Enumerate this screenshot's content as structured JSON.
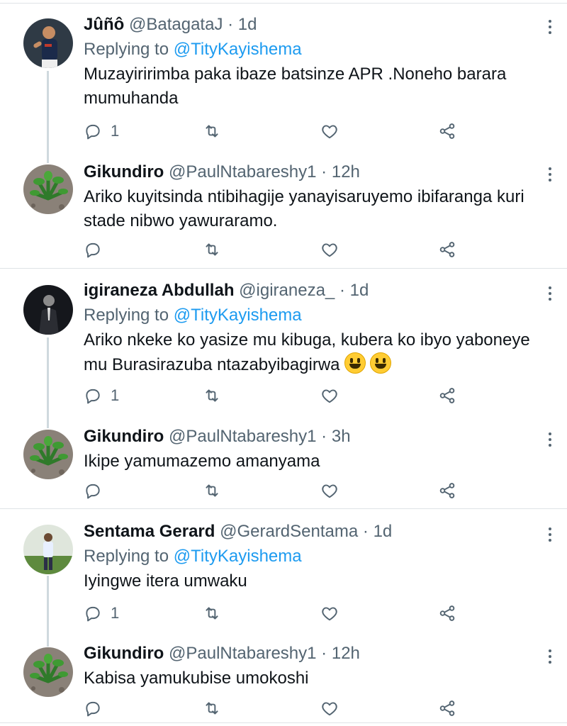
{
  "threads": [
    {
      "parent": {
        "name": "Jûñô",
        "handle": "@BatagataJ",
        "dot": "·",
        "time": "1d",
        "replying_prefix": "Replying to",
        "replying_to": "@TityKayishema",
        "text": "Muzayiririmba paka ibaze batsinze APR .Noneho barara mumuhanda",
        "reply_count": "1",
        "avatar": "soccer-player-avatar"
      },
      "reply": {
        "name": "Gikundiro",
        "handle": "@PaulNtabareshy1",
        "dot": "·",
        "time": "12h",
        "text": "Ariko kuyitsinda ntibihagije yanayisaruyemo ibifaranga kuri stade nibwo yawuraramo.",
        "reply_count": "",
        "avatar": "plant-avatar"
      }
    },
    {
      "parent": {
        "name": "igiraneza Abdullah",
        "handle": "@igiraneza_",
        "dot": "·",
        "time": "1d",
        "replying_prefix": "Replying to",
        "replying_to": "@TityKayishema",
        "text": "Ariko nkeke ko yasize mu kibuga, kubera ko ibyo yaboneye mu Burasirazuba ntazabyibagirwa",
        "reply_count": "1",
        "avatar": "man-in-suit-avatar"
      },
      "reply": {
        "name": "Gikundiro",
        "handle": "@PaulNtabareshy1",
        "dot": "·",
        "time": "3h",
        "text": "Ikipe yamumazemo amanyama",
        "reply_count": "",
        "avatar": "plant-avatar"
      }
    },
    {
      "parent": {
        "name": "Sentama Gerard",
        "handle": "@GerardSentama",
        "dot": "·",
        "time": "1d",
        "replying_prefix": "Replying to",
        "replying_to": "@TityKayishema",
        "text": "Iyingwe itera umwaku",
        "reply_count": "1",
        "avatar": "standing-man-avatar"
      },
      "reply": {
        "name": "Gikundiro",
        "handle": "@PaulNtabareshy1",
        "dot": "·",
        "time": "12h",
        "text": "Kabisa yamukubise umokoshi",
        "reply_count": "",
        "avatar": "plant-avatar"
      }
    }
  ],
  "colors": {
    "accent": "#1d9bf0",
    "muted": "#536471",
    "text": "#0f1419",
    "divider": "#dfe3e6"
  },
  "icons": [
    "reply-icon",
    "retweet-icon",
    "like-icon",
    "share-icon",
    "more-icon",
    "grinning-emoji-icon"
  ]
}
